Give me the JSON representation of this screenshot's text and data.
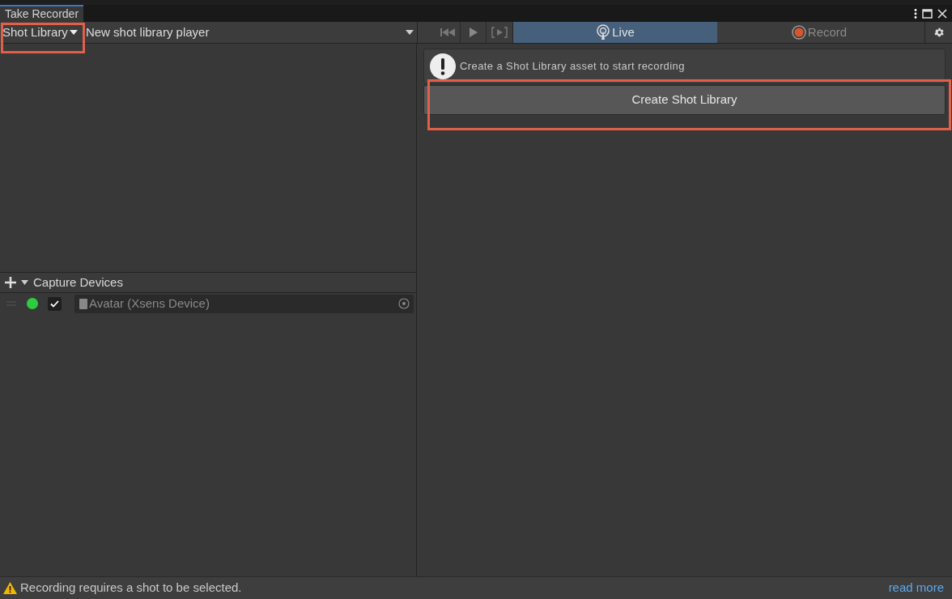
{
  "window": {
    "title": "Take Recorder"
  },
  "toolbar": {
    "source": "Shot Library",
    "player": "New shot library player",
    "modes": [
      {
        "label": "Live",
        "kind": "live",
        "selected": true
      },
      {
        "label": "Record",
        "kind": "record",
        "selected": false
      }
    ]
  },
  "notice": {
    "message": "Create a Shot Library asset to start recording",
    "button": "Create Shot Library"
  },
  "capture_devices": {
    "title": "Capture Devices",
    "devices": [
      {
        "name": "Avatar (Xsens Device)",
        "color": "#2ecc40",
        "checked": true
      }
    ]
  },
  "status_bar": {
    "message": "Recording requires a shot to be selected.",
    "link": "read more"
  }
}
